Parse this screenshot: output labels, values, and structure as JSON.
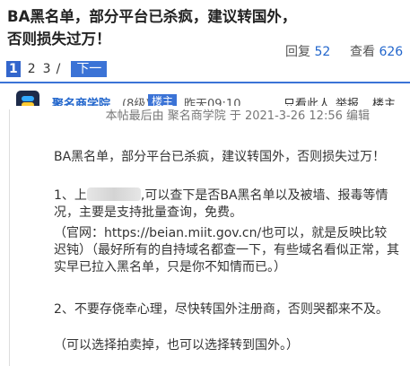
{
  "thread": {
    "title": "BA黑名单，部分平台已杀疯，建议转国外，否则损失过万！",
    "reply_label": "回复",
    "reply_count": "52",
    "view_label": "查看",
    "view_count": "626"
  },
  "pager": {
    "current": "1",
    "page2": "2",
    "page3": "3",
    "slash": "/",
    "next": "下一"
  },
  "post": {
    "author": "聚名商学院",
    "level": "(8级)",
    "badge": "楼主",
    "time": "昨天09:10",
    "action_only": "只看此人",
    "action_report": "举报",
    "action_floor": "楼主",
    "edit_note": "本帖最后由 聚名商学院 于 2021-3-26 12:56 编辑",
    "p1": "BA黑名单，部分平台已杀疯，建议转国外，否则损失过万！",
    "p2_prefix": "1、上",
    "p2_suffix": ",可以查下是否BA黑名单以及被墙、报毒等情况，主要是支持批量查询，免费。",
    "p3": "（官网：https://beian.miit.gov.cn/也可以，就是反映比较迟钝）（最好所有的自持域名都查一下，有些域名看似正常，其实早已拉入黑名单，只是你不知情而已。）",
    "p4": "2、不要存侥幸心理，尽快转国外注册商，否则哭都来不及。",
    "p5": "（可以选择拍卖掉，也可以选择转到国外。）"
  }
}
